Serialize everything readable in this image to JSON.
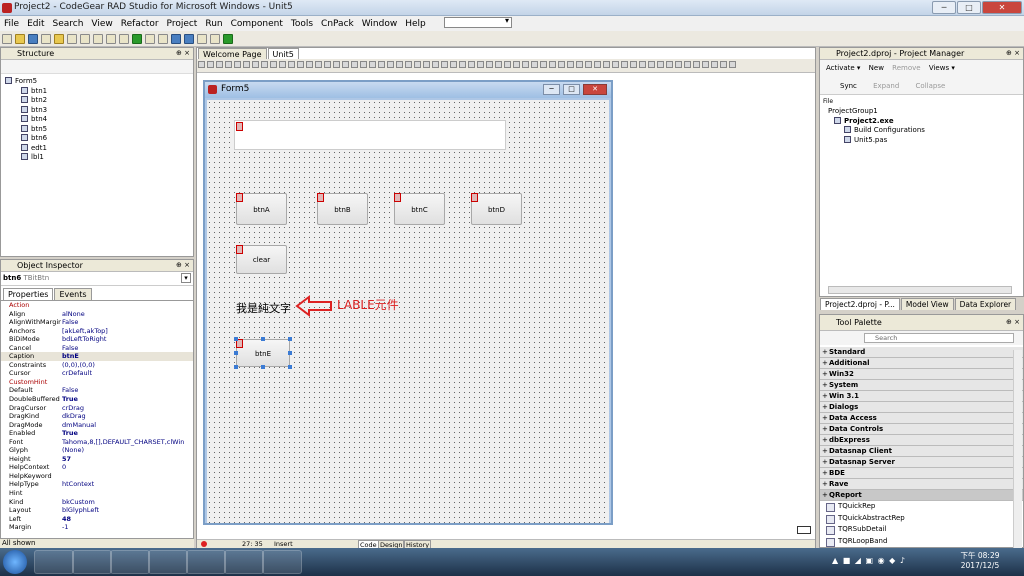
{
  "window": {
    "title": "Project2 - CodeGear RAD Studio for Microsoft Windows - Unit5",
    "min": "─",
    "max": "□",
    "close": "✕"
  },
  "menu": [
    "File",
    "Edit",
    "Search",
    "View",
    "Refactor",
    "Project",
    "Run",
    "Component",
    "Tools",
    "CnPack",
    "Window",
    "Help"
  ],
  "structure": {
    "title": "Structure",
    "items": [
      "Form5",
      "btn1",
      "btn2",
      "btn3",
      "btn4",
      "btn5",
      "btn6",
      "edt1",
      "lbl1"
    ]
  },
  "inspector": {
    "title": "Object Inspector",
    "selected": "btn6",
    "selected_type": "TBitBtn",
    "tab_props": "Properties",
    "tab_events": "Events",
    "footer": "All shown",
    "rows": [
      [
        "Action",
        ""
      ],
      [
        "Align",
        "alNone"
      ],
      [
        "AlignWithMargins",
        "False"
      ],
      [
        "Anchors",
        "[akLeft,akTop]"
      ],
      [
        "BiDiMode",
        "bdLeftToRight"
      ],
      [
        "Cancel",
        "False"
      ],
      [
        "Caption",
        "btnE"
      ],
      [
        "Constraints",
        "(0,0),(0,0)"
      ],
      [
        "Cursor",
        "crDefault"
      ],
      [
        "CustomHint",
        ""
      ],
      [
        "Default",
        "False"
      ],
      [
        "DoubleBuffered",
        "True"
      ],
      [
        "DragCursor",
        "crDrag"
      ],
      [
        "DragKind",
        "dkDrag"
      ],
      [
        "DragMode",
        "dmManual"
      ],
      [
        "Enabled",
        "True"
      ],
      [
        "Font",
        "Tahoma,8,[],DEFAULT_CHARSET,clWind"
      ],
      [
        "Glyph",
        "(None)"
      ],
      [
        "Height",
        "57"
      ],
      [
        "HelpContext",
        "0"
      ],
      [
        "HelpKeyword",
        ""
      ],
      [
        "HelpType",
        "htContext"
      ],
      [
        "Hint",
        ""
      ],
      [
        "Kind",
        "bkCustom"
      ],
      [
        "Layout",
        "blGlyphLeft"
      ],
      [
        "Left",
        "48"
      ],
      [
        "Margin",
        "-1"
      ]
    ]
  },
  "editor": {
    "tab1": "Welcome Page",
    "tab2": "Unit5",
    "status_pos": "27: 35",
    "status_mode": "Insert",
    "bottom_tabs": [
      "Code",
      "Design",
      "History"
    ]
  },
  "form": {
    "caption": "Form5",
    "buttons": [
      "btnA",
      "btnB",
      "btnC",
      "btnD"
    ],
    "clear": "clear",
    "btnE": "btnE",
    "label_text": "我是純文字",
    "annotation": "LABLE元件"
  },
  "project": {
    "title": "Project2.dproj - Project Manager",
    "activate": "Activate",
    "new": "New",
    "remove": "Remove",
    "views": "Views",
    "sync": "Sync",
    "expand": "Expand",
    "collapse": "Collapse",
    "file_col": "File",
    "tree": [
      "ProjectGroup1",
      "Project2.exe",
      "Build Configurations",
      "Unit5.pas"
    ]
  },
  "dock_tabs": [
    "Project2.dproj - P...",
    "Model View",
    "Data Explorer"
  ],
  "palette": {
    "title": "Tool Palette",
    "search_placeholder": "Search",
    "categories": [
      "Standard",
      "Additional",
      "Win32",
      "System",
      "Win 3.1",
      "Dialogs",
      "Data Access",
      "Data Controls",
      "dbExpress",
      "Datasnap Client",
      "Datasnap Server",
      "BDE",
      "Rave",
      "QReport"
    ],
    "items": [
      "TQuickRep",
      "TQuickAbstractRep",
      "TQRSubDetail",
      "TQRLoopBand"
    ]
  },
  "tray": {
    "time": "下午 08:29",
    "date": "2017/12/5"
  }
}
